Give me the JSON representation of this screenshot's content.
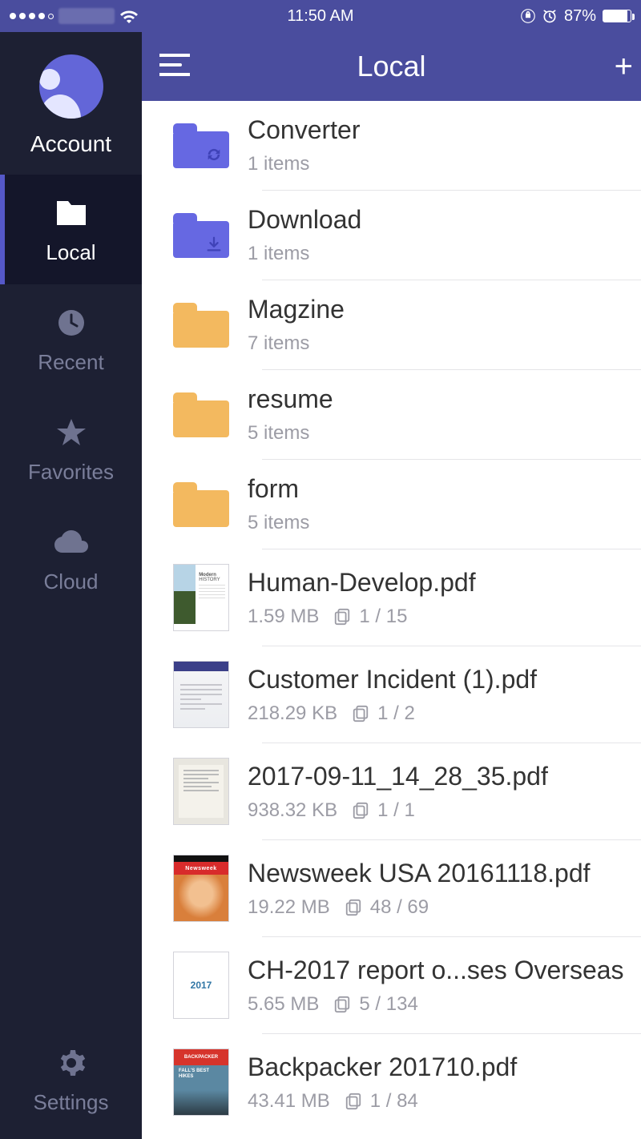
{
  "statusBar": {
    "time": "11:50 AM",
    "battery": "87%"
  },
  "sidebar": {
    "account_label": "Account",
    "items": [
      {
        "label": "Local"
      },
      {
        "label": "Recent"
      },
      {
        "label": "Favorites"
      },
      {
        "label": "Cloud"
      }
    ],
    "settings_label": "Settings"
  },
  "header": {
    "title": "Local"
  },
  "rows": [
    {
      "type": "folder",
      "color": "purple",
      "overlay": "sync",
      "title": "Converter",
      "meta": "1 items"
    },
    {
      "type": "folder",
      "color": "purple",
      "overlay": "download",
      "title": "Download",
      "meta": "1 items"
    },
    {
      "type": "folder",
      "color": "orange",
      "overlay": "",
      "title": "Magzine",
      "meta": "7 items"
    },
    {
      "type": "folder",
      "color": "orange",
      "overlay": "",
      "title": "resume",
      "meta": "5 items"
    },
    {
      "type": "folder",
      "color": "orange",
      "overlay": "",
      "title": "form",
      "meta": "5 items"
    },
    {
      "type": "pdf",
      "thumb": "hd",
      "title": "Human-Develop.pdf",
      "size": "1.59 MB",
      "pages": "1 / 15"
    },
    {
      "type": "pdf",
      "thumb": "form",
      "title": "Customer Incident (1).pdf",
      "size": "218.29 KB",
      "pages": "1 / 2"
    },
    {
      "type": "pdf",
      "thumb": "plain",
      "title": "2017-09-11_14_28_35.pdf",
      "size": "938.32 KB",
      "pages": "1 / 1"
    },
    {
      "type": "pdf",
      "thumb": "newsweek",
      "title": "Newsweek USA 20161118.pdf",
      "size": "19.22 MB",
      "pages": "48 / 69"
    },
    {
      "type": "pdf",
      "thumb": "2017",
      "title": "CH-2017 report o...ses Overseas",
      "size": "5.65 MB",
      "pages": "5 / 134"
    },
    {
      "type": "pdf",
      "thumb": "bp",
      "title": "Backpacker 201710.pdf",
      "size": "43.41 MB",
      "pages": "1 / 84"
    }
  ]
}
